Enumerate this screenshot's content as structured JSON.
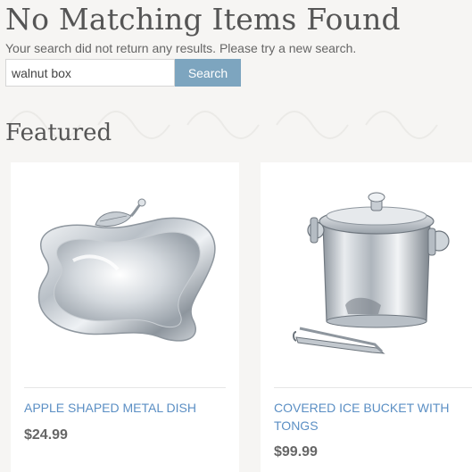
{
  "page": {
    "title": "No Matching Items Found",
    "message": "Your search did not return any results. Please try a new search."
  },
  "search": {
    "value": "walnut box",
    "button_label": "Search"
  },
  "featured": {
    "heading": "Featured",
    "products": [
      {
        "name": "APPLE SHAPED METAL DISH",
        "price": "$24.99",
        "image_icon": "apple-dish-image"
      },
      {
        "name": "COVERED ICE BUCKET WITH TONGS",
        "price": "$99.99",
        "image_icon": "ice-bucket-image"
      }
    ]
  },
  "colors": {
    "accent_button": "#7da5bf",
    "link": "#5b8fc4",
    "background": "#f6f5f3"
  }
}
